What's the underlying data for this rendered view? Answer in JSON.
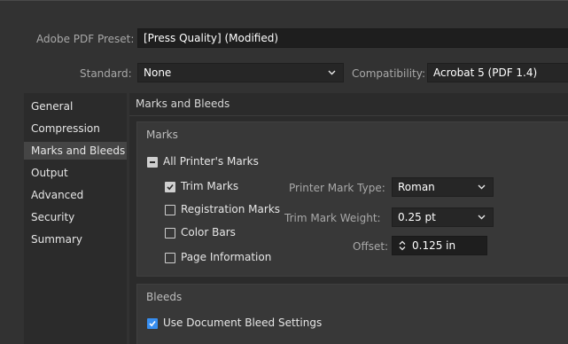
{
  "preset": {
    "label": "Adobe PDF Preset:",
    "value": "[Press Quality] (Modified)"
  },
  "standard": {
    "label": "Standard:",
    "value": "None"
  },
  "compatibility": {
    "label": "Compatibility:",
    "value": "Acrobat 5 (PDF 1.4)"
  },
  "sidebar": {
    "items": [
      {
        "label": "General",
        "selected": false
      },
      {
        "label": "Compression",
        "selected": false
      },
      {
        "label": "Marks and Bleeds",
        "selected": true
      },
      {
        "label": "Output",
        "selected": false
      },
      {
        "label": "Advanced",
        "selected": false
      },
      {
        "label": "Security",
        "selected": false
      },
      {
        "label": "Summary",
        "selected": false
      }
    ]
  },
  "panel": {
    "title": "Marks and Bleeds",
    "marks": {
      "heading": "Marks",
      "all_printers_marks": {
        "label": "All Printer's Marks",
        "state": "mixed"
      },
      "trim_marks": {
        "label": "Trim Marks",
        "checked": true
      },
      "registration_marks": {
        "label": "Registration Marks",
        "checked": false
      },
      "color_bars": {
        "label": "Color Bars",
        "checked": false
      },
      "page_information": {
        "label": "Page Information",
        "checked": false
      },
      "printer_mark_type": {
        "label": "Printer Mark Type:",
        "value": "Roman"
      },
      "trim_mark_weight": {
        "label": "Trim Mark Weight:",
        "value": "0.25 pt"
      },
      "offset": {
        "label": "Offset:",
        "value": "0.125 in"
      }
    },
    "bleeds": {
      "heading": "Bleeds",
      "use_document_bleed": {
        "label": "Use Document Bleed Settings",
        "checked": true
      }
    }
  },
  "icons": {
    "dropdown": "chevron-down-icon",
    "stepper": "stepper-arrows-icon",
    "check": "checkmark-icon",
    "mixed": "dash-icon"
  },
  "colors": {
    "background": "#323232",
    "panel": "#2b2b2b",
    "group": "#383838",
    "selected": "#454545",
    "accent": "#378ef0"
  }
}
